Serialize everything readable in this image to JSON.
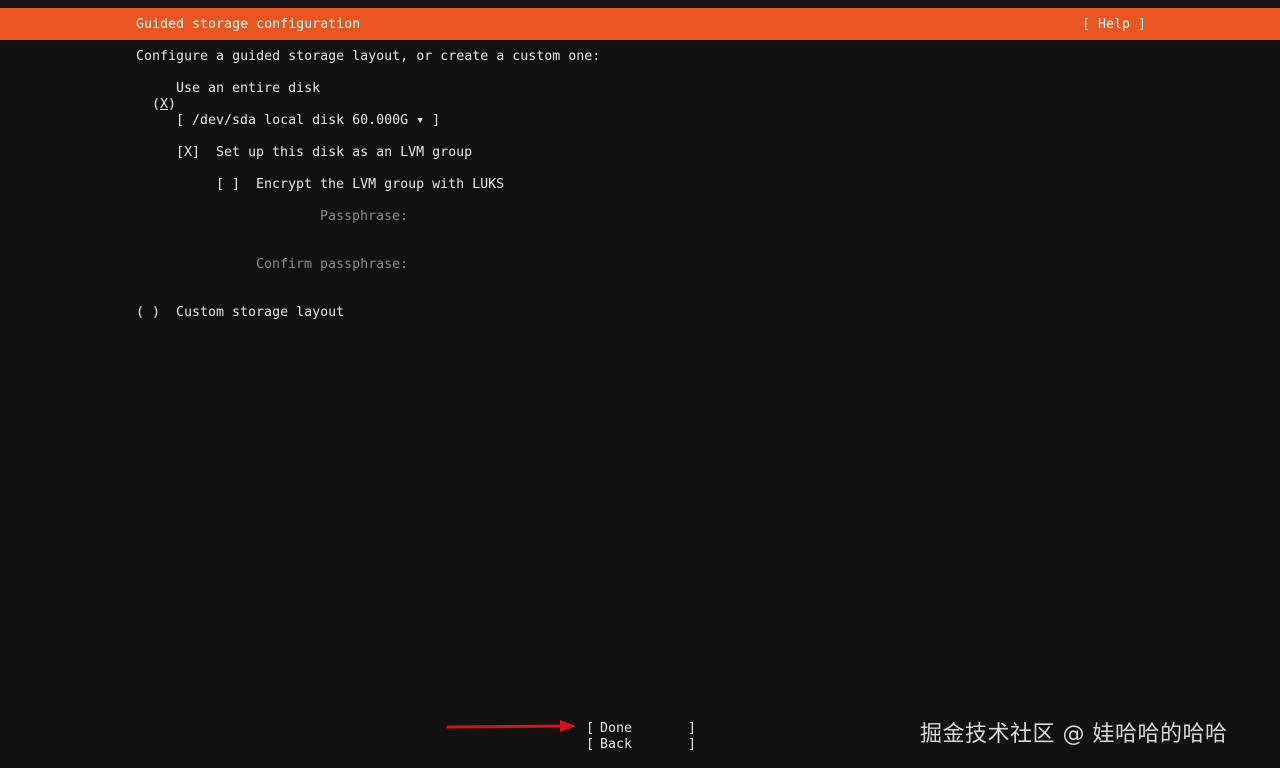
{
  "header": {
    "title": "Guided storage configuration",
    "help_label": "[ Help ]",
    "accent_color": "#e95420"
  },
  "intro": "Configure a guided storage layout, or create a custom one:",
  "options": {
    "entire_disk": {
      "radio_open": "(",
      "radio_mark": "X",
      "radio_close": ")",
      "label": "Use an entire disk"
    },
    "disk_select": {
      "value": "[ /dev/sda local disk 60.000G ▾ ]"
    },
    "lvm": {
      "checkbox": "[X]",
      "label": "Set up this disk as an LVM group"
    },
    "encrypt": {
      "checkbox": "[ ]",
      "label": "Encrypt the LVM group with LUKS"
    },
    "passphrase": {
      "label": "Passphrase:"
    },
    "confirm_passphrase": {
      "label": "Confirm passphrase:"
    },
    "custom": {
      "radio": "( )",
      "label": "Custom storage layout"
    }
  },
  "buttons": {
    "done": {
      "label": "Done",
      "open": "[",
      "close": "]"
    },
    "back": {
      "label": "Back",
      "open": "[",
      "close": "]"
    }
  },
  "annotation": {
    "arrow_icon": "red-arrow-icon",
    "arrow_color": "#e01010"
  },
  "watermark": "掘金技术社区 @ 娃哈哈的哈哈"
}
